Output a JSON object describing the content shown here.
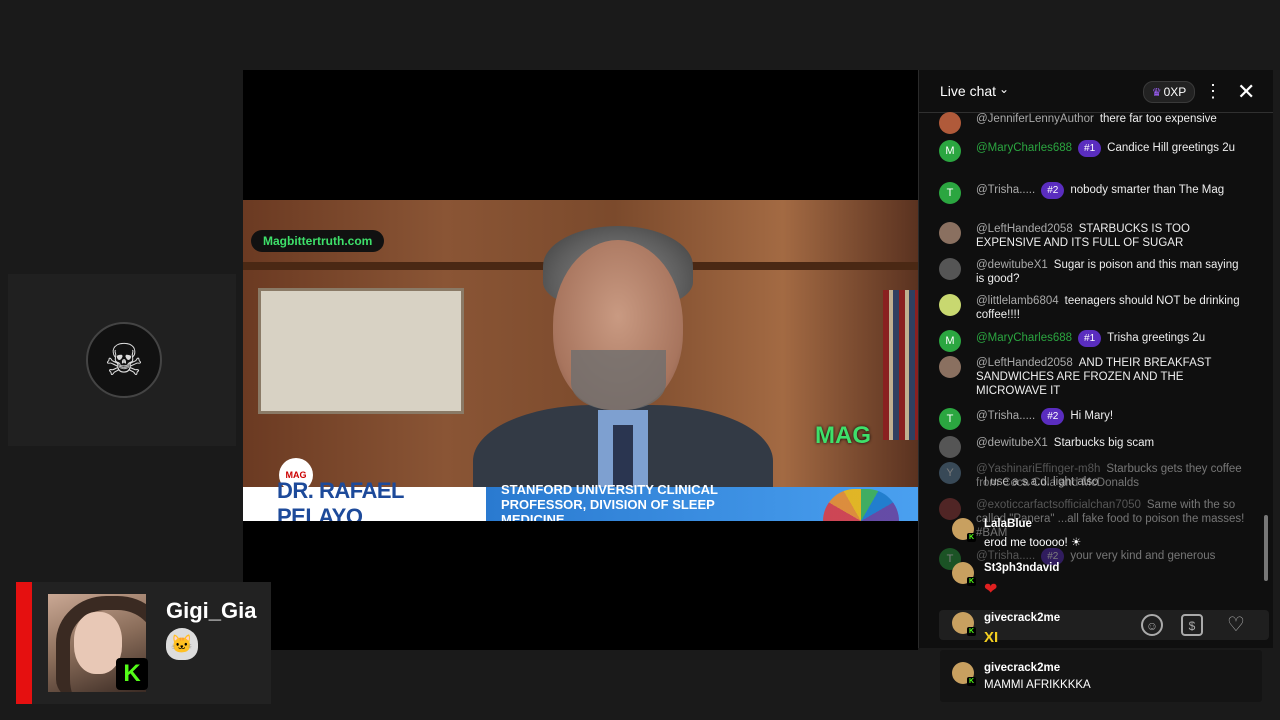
{
  "video": {
    "site_tag": "Magbittertruth.com",
    "mag_logo": "MAG",
    "mag_circle": "MAG",
    "lower_third_name": "DR. RAFAEL PELAYO",
    "lower_third_title": "STANFORD UNIVERSITY CLINICAL PROFESSOR, DIVISION OF SLEEP MEDICINE"
  },
  "streamer": {
    "name": "Gigi_Gia",
    "platform_badge": "K",
    "accent_color": "#e51010",
    "emote_icon": "cat-emote"
  },
  "chat": {
    "title": "Live chat",
    "xp_label": "0XP",
    "messages": [
      {
        "author": "@JenniferLennyAuthor",
        "badge": "",
        "text": "there far too expensive",
        "avatar": "",
        "avatar_color": "#b05a3a",
        "green": false
      },
      {
        "author": "@MaryCharles688",
        "badge": "#1",
        "text": "Candice Hill greetings 2u",
        "avatar": "M",
        "avatar_color": "#2ba640",
        "green": true
      },
      {
        "author": "@Trisha.....",
        "badge": "#2",
        "text": "nobody smarter than The Mag",
        "avatar": "T",
        "avatar_color": "#2ba640",
        "green": false
      },
      {
        "author": "@LeftHanded2058",
        "badge": "",
        "text": "STARBUCKS IS TOO EXPENSIVE AND ITS FULL OF SUGAR",
        "avatar": "",
        "avatar_color": "#8a7060",
        "green": false
      },
      {
        "author": "@dewitubeX1",
        "badge": "",
        "text": "Sugar is poison and this man saying is good?",
        "avatar": "",
        "avatar_color": "#555555",
        "green": false
      },
      {
        "author": "@littlelamb6804",
        "badge": "",
        "text": "teenagers should NOT be drinking coffee!!!!",
        "avatar": "",
        "avatar_color": "#c8d870",
        "green": false
      },
      {
        "author": "@MaryCharles688",
        "badge": "#1",
        "text": "Trisha greetings 2u",
        "avatar": "M",
        "avatar_color": "#2ba640",
        "green": true
      },
      {
        "author": "@LeftHanded2058",
        "badge": "",
        "text": "AND THEIR BREAKFAST SANDWICHES ARE FROZEN AND THE MICROWAVE IT",
        "avatar": "",
        "avatar_color": "#8a7060",
        "green": false
      },
      {
        "author": "@Trisha.....",
        "badge": "#2",
        "text": "Hi Mary!",
        "avatar": "T",
        "avatar_color": "#2ba640",
        "green": false
      },
      {
        "author": "@dewitubeX1",
        "badge": "",
        "text": "Starbucks big scam",
        "avatar": "",
        "avatar_color": "#555555",
        "green": false
      },
      {
        "author": "@YashinariEffinger-m8h",
        "badge": "",
        "text": "Starbucks gets they coffee from Coca Cola and McDonalds",
        "avatar": "Y",
        "avatar_color": "#6b8fb0",
        "green": false
      },
      {
        "author": "@exoticcarfactsofficialchan7050",
        "badge": "",
        "text": "Same with the so called \"Panera\" ...all fake food to poison the masses! #BAM",
        "avatar": "",
        "avatar_color": "#a04040",
        "green": false
      },
      {
        "author": "@Trisha.....",
        "badge": "#2",
        "text": "your very kind and generous",
        "avatar": "T",
        "avatar_color": "#2ba640",
        "green": false
      }
    ],
    "icons": {
      "menu": "more-vert-icon",
      "close": "close-icon",
      "emoji": "emoji-icon",
      "super_chat": "super-chat-icon",
      "heart": "heart-icon"
    }
  },
  "overlay": {
    "messages": [
      {
        "user": "",
        "text": "I use a s.a.d. light also"
      },
      {
        "user": "LalaBlue",
        "text": "erod me tooooo! ☀"
      },
      {
        "user": "St3ph3ndavid",
        "text": "❤"
      },
      {
        "user": "givecrack2me",
        "text": "XI"
      },
      {
        "user": "givecrack2me",
        "text": "MAMMI AFRIKKKKA"
      }
    ]
  }
}
